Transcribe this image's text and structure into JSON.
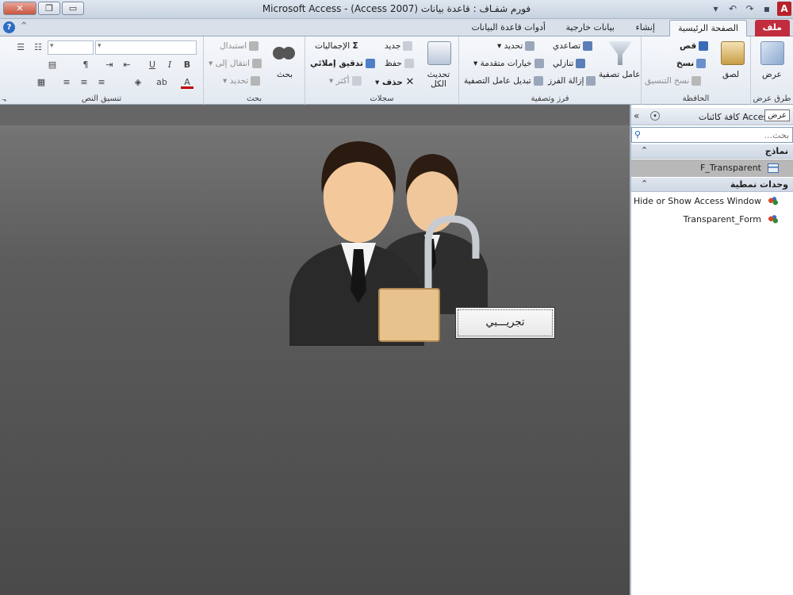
{
  "window": {
    "title": "Microsoft Access - (Access 2007) فورم شفـاف : قاعدة بيانات"
  },
  "window_controls": {
    "close": "✕",
    "restore": "❐",
    "minimize": "▭"
  },
  "qat": {
    "undo": "↶",
    "redo": "↷",
    "save": "▪",
    "customize": "▾"
  },
  "app_icon_letter": "A",
  "tabs": [
    {
      "label": "ملف"
    },
    {
      "label": "الصفحة الرئيسية"
    },
    {
      "label": "إنشاء"
    },
    {
      "label": "بيانات خارجية"
    },
    {
      "label": "أدوات قاعدة البيانات"
    }
  ],
  "help_symbol": "?",
  "minimize_ribbon_symbol": "^",
  "ribbon": {
    "views": {
      "label": "عرض",
      "group": "طرق عرض"
    },
    "clipboard": {
      "group": "الحافظة",
      "paste": "لصق",
      "cut": "قص",
      "copy": "نسخ",
      "format_painter": "نسخ التنسيق"
    },
    "sort_filter": {
      "group": "فرز وتصفية",
      "filter": "عامل تصفية",
      "ascending": "تصاعدي",
      "descending": "تنازلي",
      "remove_sort": "إزالة الفرز",
      "selection": "تحديد",
      "advanced": "خيارات متقدمة",
      "toggle_filter": "تبديل عامل التصفية"
    },
    "records": {
      "group": "سجلات",
      "refresh_all": "تحديث الكل",
      "new": "جديد",
      "save": "حفظ",
      "delete": "حذف",
      "totals": "الإجماليات",
      "spelling": "تدقيق إملائي",
      "more": "أكثر"
    },
    "find": {
      "group": "بحث",
      "find": "بحث",
      "replace": "استبدال",
      "goto": "انتقال إلى",
      "select": "تحديد"
    },
    "text_formatting": {
      "group": "تنسيق النص",
      "bold": "B",
      "italic": "I",
      "underline": "U",
      "font_color": "A"
    }
  },
  "form": {
    "trial_button_label": "تجريـــبي"
  },
  "nav_pane": {
    "title": "كافة كائنات Access",
    "tooltip": "عرض",
    "collapse_symbol": "«",
    "search_placeholder": "بحث...",
    "sections": [
      {
        "label": "نماذج",
        "items": [
          {
            "name": "F_Transparent",
            "selected": true
          }
        ]
      },
      {
        "label": "وحدات نمطية",
        "items": [
          {
            "name": "Hide or Show Access Window"
          },
          {
            "name": "Transparent_Form"
          }
        ]
      }
    ]
  },
  "colors": {
    "file_tab": "#c12d3e",
    "canvas_bg": "#4f4f4f",
    "nav_selected": "#b8b8b8"
  }
}
